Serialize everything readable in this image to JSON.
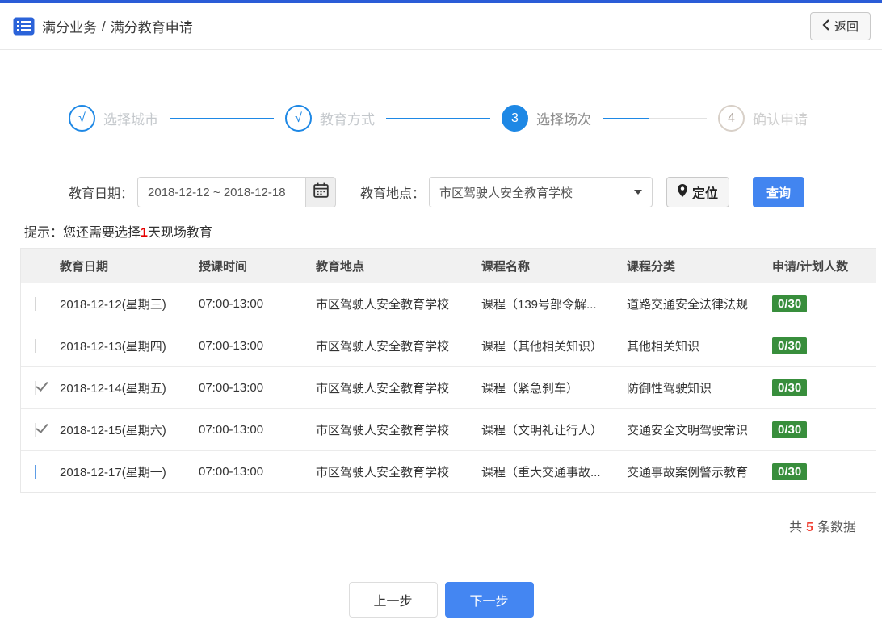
{
  "colors": {
    "topbar_blue": "#2a5cd7",
    "primary_blue": "#4285f0",
    "stepper_blue": "#1e88e5",
    "badge_green": "#388e3c",
    "hint_red": "#e60000",
    "count_red": "#f04134"
  },
  "header": {
    "title_primary": "满分业务",
    "title_separator": "/",
    "title_secondary": "满分教育申请",
    "back_label": "返回"
  },
  "stepper": {
    "steps": [
      {
        "marker": "√",
        "label": "选择城市",
        "state": "done"
      },
      {
        "marker": "√",
        "label": "教育方式",
        "state": "done"
      },
      {
        "marker": "3",
        "label": "选择场次",
        "state": "active"
      },
      {
        "marker": "4",
        "label": "确认申请",
        "state": "pending"
      }
    ]
  },
  "filters": {
    "date_label": "教育日期：",
    "date_value": "2018-12-12 ~ 2018-12-18",
    "location_label": "教育地点：",
    "location_value": "市区驾驶人安全教育学校",
    "locate_label": "定位",
    "search_label": "查询"
  },
  "hint": {
    "prefix": "提示：您还需要选择",
    "count": "1",
    "suffix": "天现场教育"
  },
  "table": {
    "headers": [
      "教育日期",
      "授课时间",
      "教育地点",
      "课程名称",
      "课程分类",
      "申请/计划人数"
    ],
    "rows": [
      {
        "checked": false,
        "highlighted": false,
        "date": "2018-12-12(星期三)",
        "time": "07:00-13:00",
        "location": "市区驾驶人安全教育学校",
        "course": "课程（139号部令解...",
        "category": "道路交通安全法律法规",
        "quota": "0/30"
      },
      {
        "checked": false,
        "highlighted": false,
        "date": "2018-12-13(星期四)",
        "time": "07:00-13:00",
        "location": "市区驾驶人安全教育学校",
        "course": "课程（其他相关知识）",
        "category": "其他相关知识",
        "quota": "0/30"
      },
      {
        "checked": true,
        "highlighted": false,
        "date": "2018-12-14(星期五)",
        "time": "07:00-13:00",
        "location": "市区驾驶人安全教育学校",
        "course": "课程（紧急刹车）",
        "category": "防御性驾驶知识",
        "quota": "0/30"
      },
      {
        "checked": true,
        "highlighted": false,
        "date": "2018-12-15(星期六)",
        "time": "07:00-13:00",
        "location": "市区驾驶人安全教育学校",
        "course": "课程（文明礼让行人）",
        "category": "交通安全文明驾驶常识",
        "quota": "0/30"
      },
      {
        "checked": false,
        "highlighted": true,
        "date": "2018-12-17(星期一)",
        "time": "07:00-13:00",
        "location": "市区驾驶人安全教育学校",
        "course": "课程（重大交通事故...",
        "category": "交通事故案例警示教育",
        "quota": "0/30"
      }
    ]
  },
  "summary": {
    "prefix": "共",
    "count": "5",
    "suffix": "条数据"
  },
  "footer": {
    "prev_label": "上一步",
    "next_label": "下一步"
  }
}
